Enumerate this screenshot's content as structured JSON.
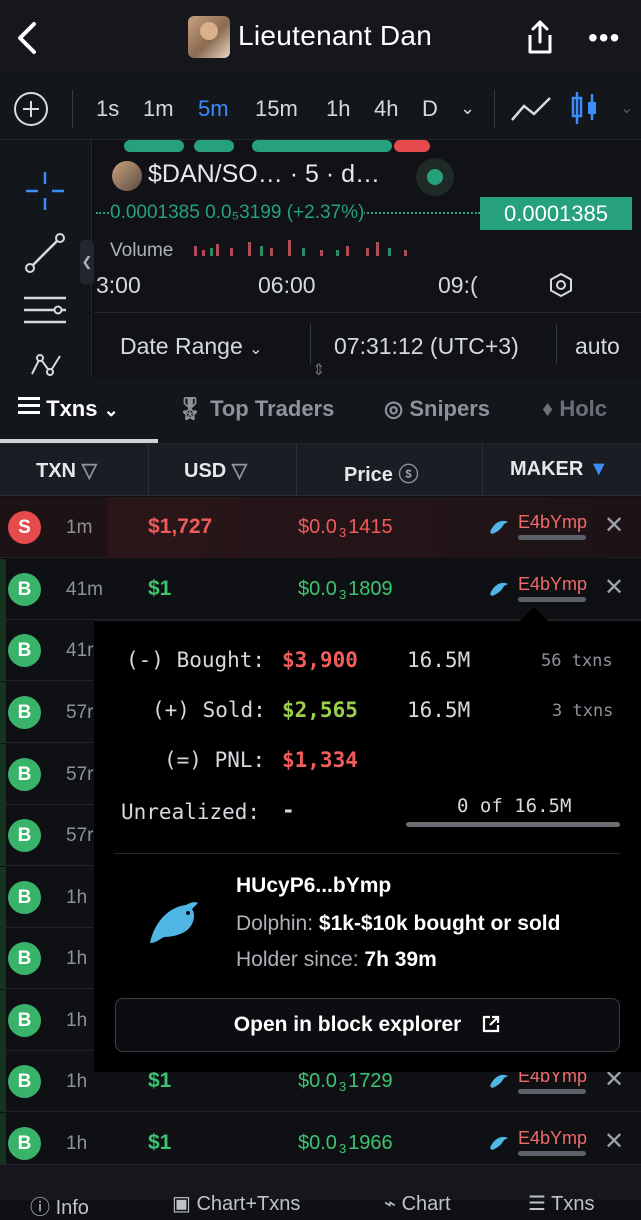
{
  "header": {
    "title": "Lieutenant Dan"
  },
  "toolbar": {
    "intervals": [
      "1s",
      "1m",
      "5m",
      "15m",
      "1h",
      "4h",
      "D"
    ],
    "active_interval": "5m"
  },
  "chart": {
    "pair": "$DAN/SO…",
    "pair_meta": "· 5 · d…",
    "price_text": "0.0001385  0.0₅3199 (+2.37%)",
    "price_tag": "0.0001385",
    "volume_label": "Volume",
    "times": [
      "3:00",
      "06:00",
      "09:("
    ],
    "date_range": "Date Range",
    "clock": "07:31:12 (UTC+3)",
    "scale": "auto"
  },
  "tabs": [
    {
      "label": "Txns"
    },
    {
      "label": "Top Traders"
    },
    {
      "label": "Snipers"
    },
    {
      "label": "Holc"
    }
  ],
  "table": {
    "headers": {
      "txn": "TXN",
      "usd": "USD",
      "price": "Price",
      "maker": "MAKER"
    },
    "rows": [
      {
        "type": "S",
        "age": "1m",
        "usd": "$1,727",
        "price_pre": "$0.0",
        "price_sub": "3",
        "price_post": "1415",
        "maker": "E4bYmp"
      },
      {
        "type": "B",
        "age": "41m",
        "usd": "$1",
        "price_pre": "$0.0",
        "price_sub": "3",
        "price_post": "1809",
        "maker": "E4bYmp"
      },
      {
        "type": "B",
        "age": "41r"
      },
      {
        "type": "B",
        "age": "57r"
      },
      {
        "type": "B",
        "age": "57r"
      },
      {
        "type": "B",
        "age": "57r"
      },
      {
        "type": "B",
        "age": "1h"
      },
      {
        "type": "B",
        "age": "1h"
      },
      {
        "type": "B",
        "age": "1h"
      },
      {
        "type": "B",
        "age": "1h",
        "usd": "$1",
        "price_pre": "$0.0",
        "price_sub": "3",
        "price_post": "1729",
        "maker": "E4bYmp"
      },
      {
        "type": "B",
        "age": "1h",
        "usd": "$1",
        "price_pre": "$0.0",
        "price_sub": "3",
        "price_post": "1966",
        "maker": "E4bYmp"
      }
    ]
  },
  "popover": {
    "bought_label": "(-) Bought:",
    "bought_usd": "$3,900",
    "bought_tokens": "16.5M",
    "bought_txns": "56 txns",
    "sold_label": "(+) Sold:",
    "sold_usd": "$2,565",
    "sold_tokens": "16.5M",
    "sold_txns": "3 txns",
    "pnl_label": "(=) PNL:",
    "pnl_usd": "$1,334",
    "unrealized_label": "Unrealized:",
    "unrealized_value": "-",
    "holding": "0 of 16.5M",
    "wallet": "HUcyP6...bYmp",
    "tier_label": "Dolphin:",
    "tier_desc": "$1k-$10k bought or sold",
    "holder_label": "Holder since:",
    "holder_value": "7h 39m",
    "explorer_button": "Open in block explorer"
  },
  "bottom_tabs": [
    "Info",
    "Chart+Txns",
    "Chart",
    "Txns"
  ]
}
